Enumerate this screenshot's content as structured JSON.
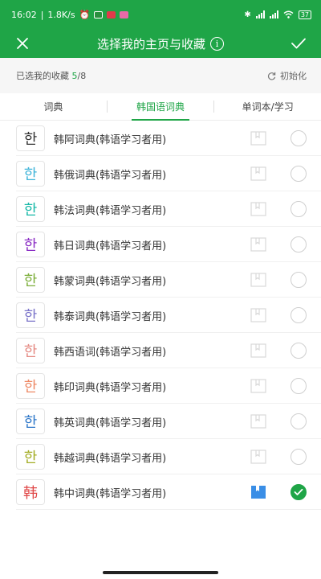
{
  "status_bar": {
    "time": "16:02",
    "speed": "1.8K/s",
    "battery": "37",
    "icons": [
      "signal-n-icon",
      "mute-icon",
      "alarm-icon",
      "app-icon-green",
      "app-icon-red",
      "app-icon-pink",
      "bluetooth-icon",
      "cell-signal-icon",
      "cell-signal-icon",
      "wifi-icon",
      "battery-icon"
    ]
  },
  "header": {
    "title": "选择我的主页与收藏",
    "info_icon": "i",
    "close_icon": "close-icon",
    "confirm_icon": "check-icon"
  },
  "subheader": {
    "label": "已选我的收藏",
    "selected": "5",
    "total": "/8",
    "reset_label": "初始化"
  },
  "tabs": [
    {
      "label": "词典",
      "active": false
    },
    {
      "label": "韩国语词典",
      "active": true
    },
    {
      "label": "单词本/学习",
      "active": false
    }
  ],
  "colors": {
    "accent": "#1fa547",
    "bookmark_active": "#3a8ee6"
  },
  "dictionaries": [
    {
      "badge": "한",
      "badge_color": "#333333",
      "label": "韩阿词典(韩语学习者用)",
      "bookmarked": false,
      "selected": false
    },
    {
      "badge": "한",
      "badge_color": "#3fb4d9",
      "label": "韩俄词典(韩语学习者用)",
      "bookmarked": false,
      "selected": false
    },
    {
      "badge": "한",
      "badge_color": "#18b9a8",
      "label": "韩法词典(韩语学习者用)",
      "bookmarked": false,
      "selected": false
    },
    {
      "badge": "한",
      "badge_color": "#8a2cc4",
      "label": "韩日词典(韩语学习者用)",
      "bookmarked": false,
      "selected": false
    },
    {
      "badge": "한",
      "badge_color": "#7cae3a",
      "label": "韩蒙词典(韩语学习者用)",
      "bookmarked": false,
      "selected": false
    },
    {
      "badge": "한",
      "badge_color": "#7b74c9",
      "label": "韩泰词典(韩语学习者用)",
      "bookmarked": false,
      "selected": false
    },
    {
      "badge": "한",
      "badge_color": "#e58a83",
      "label": "韩西语词(韩语学习者用)",
      "bookmarked": false,
      "selected": false
    },
    {
      "badge": "한",
      "badge_color": "#ee8a66",
      "label": "韩印词典(韩语学习者用)",
      "bookmarked": false,
      "selected": false
    },
    {
      "badge": "한",
      "badge_color": "#2f78c9",
      "label": "韩英词典(韩语学习者用)",
      "bookmarked": false,
      "selected": false
    },
    {
      "badge": "한",
      "badge_color": "#a4ad25",
      "label": "韩越词典(韩语学习者用)",
      "bookmarked": false,
      "selected": false
    },
    {
      "badge": "韩",
      "badge_color": "#e04848",
      "label": "韩中词典(韩语学习者用)",
      "bookmarked": true,
      "selected": true
    }
  ]
}
